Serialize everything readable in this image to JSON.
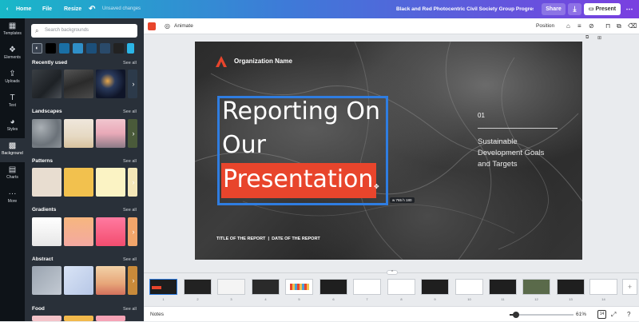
{
  "topbar": {
    "home": "Home",
    "file": "File",
    "resize": "Resize",
    "unsaved": "Unsaved changes",
    "doc_title": "Black and Red Photocentric Civil Society Group Progress Re...",
    "share": "Share",
    "present": "Present"
  },
  "rail": [
    {
      "label": "Templates",
      "icon": "templates-icon",
      "glyph": "▦"
    },
    {
      "label": "Elements",
      "icon": "elements-icon",
      "glyph": "❖"
    },
    {
      "label": "Uploads",
      "icon": "uploads-icon",
      "glyph": "⇪"
    },
    {
      "label": "Text",
      "icon": "text-icon",
      "glyph": "T"
    },
    {
      "label": "Styles",
      "icon": "styles-icon",
      "glyph": "◕"
    },
    {
      "label": "Background",
      "icon": "background-icon",
      "glyph": "▩"
    },
    {
      "label": "Charts",
      "icon": "charts-icon",
      "glyph": "▤"
    },
    {
      "label": "More",
      "icon": "more-icon",
      "glyph": "···"
    }
  ],
  "panel": {
    "search_placeholder": "Search backgrounds",
    "swatches": [
      "#000000",
      "#1a6fa5",
      "#2f8fc8",
      "#1c4f7a",
      "#2a4a6a",
      "#222222",
      "#2bb5e6"
    ],
    "sections": [
      {
        "title": "Recently used",
        "see_all": "See all"
      },
      {
        "title": "Landscapes",
        "see_all": "See all"
      },
      {
        "title": "Patterns",
        "see_all": "See all"
      },
      {
        "title": "Gradients",
        "see_all": "See all"
      },
      {
        "title": "Abstract",
        "see_all": "See all"
      },
      {
        "title": "Food",
        "see_all": "See all"
      }
    ]
  },
  "editor": {
    "color_swatch": "#e8452c",
    "animate": "Animate",
    "position": "Position"
  },
  "slide": {
    "org_name": "Organization Name",
    "title_line1": "Reporting On",
    "title_line2": "Our",
    "title_line3": "Presentation",
    "size_badge": "w 765 h 180",
    "number": "01",
    "side_text_1": "Sustainable",
    "side_text_2": "Development Goals",
    "side_text_3": "and Targets",
    "footer": "TITLE OF THE REPORT  |  DATE OF THE REPORT",
    "accent": "#e8452c",
    "selection": "#2f7de1"
  },
  "pages": [
    "1",
    "2",
    "3",
    "4",
    "5",
    "6",
    "7",
    "8",
    "9",
    "10",
    "11",
    "12",
    "13",
    "14"
  ],
  "bottombar": {
    "notes": "Notes",
    "zoom": "61%",
    "page_count": "14"
  }
}
